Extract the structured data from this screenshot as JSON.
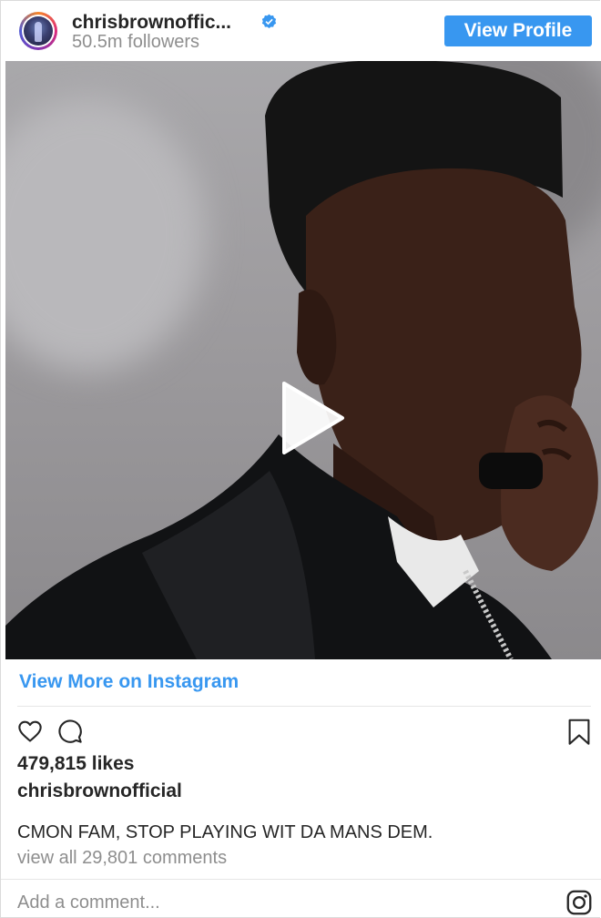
{
  "header": {
    "username": "chrisbrownoffic...",
    "followers": "50.5m followers",
    "view_profile_label": "View Profile",
    "avatar_icon": "profile-avatar",
    "verified_icon": "verified-badge-icon"
  },
  "media": {
    "type": "video",
    "play_icon": "play-icon"
  },
  "links": {
    "view_more": "View More on Instagram"
  },
  "actions": {
    "like_icon": "heart-icon",
    "comment_icon": "comment-icon",
    "save_icon": "bookmark-icon"
  },
  "post": {
    "likes": "479,815 likes",
    "caption_user": "chrisbrownofficial",
    "caption_text": "CMON FAM, STOP PLAYING WIT DA MANS DEM.",
    "view_comments": "view all 29,801 comments"
  },
  "comment_box": {
    "placeholder": "Add a comment...",
    "instagram_icon": "instagram-icon"
  },
  "colors": {
    "accent": "#3897f0",
    "text": "#262626",
    "muted": "#8e8e8e",
    "verified": "#3897f0"
  }
}
